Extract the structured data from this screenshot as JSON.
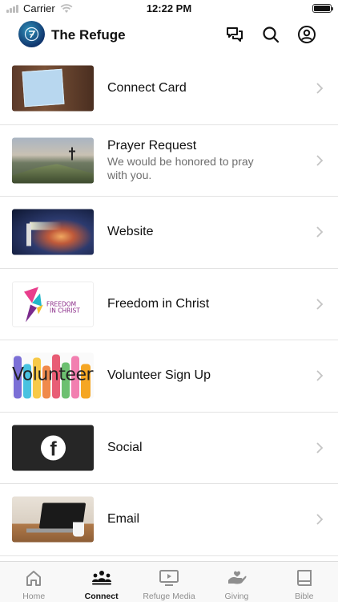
{
  "status_bar": {
    "carrier": "Carrier",
    "time": "12:22 PM"
  },
  "header": {
    "title": "The Refuge",
    "actions": [
      "chat-icon",
      "search-icon",
      "account-icon"
    ]
  },
  "items": [
    {
      "title": "Connect Card",
      "subtitle": "",
      "thumbnail": "connect-card-image"
    },
    {
      "title": "Prayer Request",
      "subtitle": "We would be honored to pray with you.",
      "thumbnail": "prayer-request-image"
    },
    {
      "title": "Website",
      "subtitle": "",
      "thumbnail": "website-image"
    },
    {
      "title": "Freedom in Christ",
      "subtitle": "",
      "thumbnail": "freedom-in-christ-image",
      "thumbnail_text": [
        "FREEDOM",
        "IN CHRIST"
      ]
    },
    {
      "title": "Volunteer Sign Up",
      "subtitle": "",
      "thumbnail": "volunteer-image",
      "thumbnail_text": "Volunteer"
    },
    {
      "title": "Social",
      "subtitle": "",
      "thumbnail": "facebook-image",
      "thumbnail_text": "f"
    },
    {
      "title": "Email",
      "subtitle": "",
      "thumbnail": "email-image"
    }
  ],
  "tabs": [
    {
      "label": "Home",
      "icon": "home-icon",
      "active": false
    },
    {
      "label": "Connect",
      "icon": "connect-icon",
      "active": true
    },
    {
      "label": "Refuge Media",
      "icon": "media-icon",
      "active": false
    },
    {
      "label": "Giving",
      "icon": "giving-icon",
      "active": false
    },
    {
      "label": "Bible",
      "icon": "bible-icon",
      "active": false
    }
  ],
  "colors": {
    "active_tab": "#111111",
    "inactive_tab": "#8e8e8e",
    "divider": "#e3e3e3"
  }
}
